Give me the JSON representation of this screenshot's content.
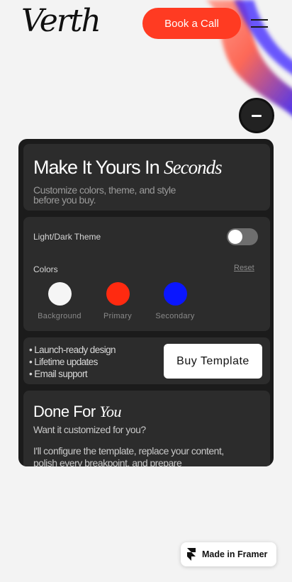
{
  "header": {
    "logo": "Verth",
    "cta_label": "Book a Call"
  },
  "customizer": {
    "title_regular": "Make It Yours In ",
    "title_italic": "Seconds",
    "subtitle": "Customize colors, theme, and style before you buy.",
    "theme_label": "Light/Dark Theme",
    "theme_toggle_on": false,
    "colors_label": "Colors",
    "reset_label": "Reset",
    "swatches": [
      {
        "label": "Background",
        "color": "#f5f5f5"
      },
      {
        "label": "Primary",
        "color": "#ff2a10"
      },
      {
        "label": "Secondary",
        "color": "#0a16ff"
      }
    ]
  },
  "purchase": {
    "features": [
      "• Launch-ready design",
      "• Lifetime updates",
      "• Email support"
    ],
    "buy_label": "Buy Template"
  },
  "done_for_you": {
    "title_regular": "Done For ",
    "title_italic": "You",
    "subtitle": "Want it customized for you?",
    "body": "I'll configure the template, replace your content, polish every breakpoint, and prepare"
  },
  "badge": {
    "label": "Made in Framer"
  },
  "colors": {
    "accent": "#ff3b22",
    "page_background": "#f3f3f3",
    "panel_background": "#1b1b1b",
    "card_background": "#2c2c2c"
  }
}
